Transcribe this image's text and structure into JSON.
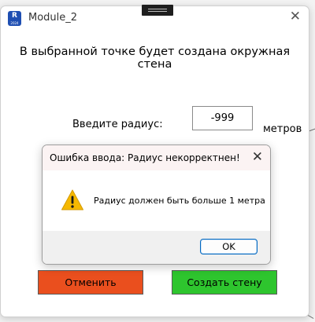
{
  "window": {
    "title": "Module_2",
    "icon_letter": "R",
    "icon_sub": "2024",
    "close_glyph": "✕"
  },
  "form": {
    "instruction": "В выбранной точке будет создана окружная стена",
    "radius_label": "Введите радиус:",
    "radius_value": "-999",
    "units": "метров"
  },
  "buttons": {
    "cancel": "Отменить",
    "create": "Создать стену"
  },
  "dialog": {
    "title": "Ошибка ввода: Радиус некорректнен!",
    "close_glyph": "✕",
    "icon": "warning-icon",
    "message": "Радиус должен быть больше 1 метра",
    "ok": "OK"
  },
  "colors": {
    "cancel_bg": "#ea4f1e",
    "create_bg": "#2ec52e",
    "warning": "#f5b800"
  }
}
